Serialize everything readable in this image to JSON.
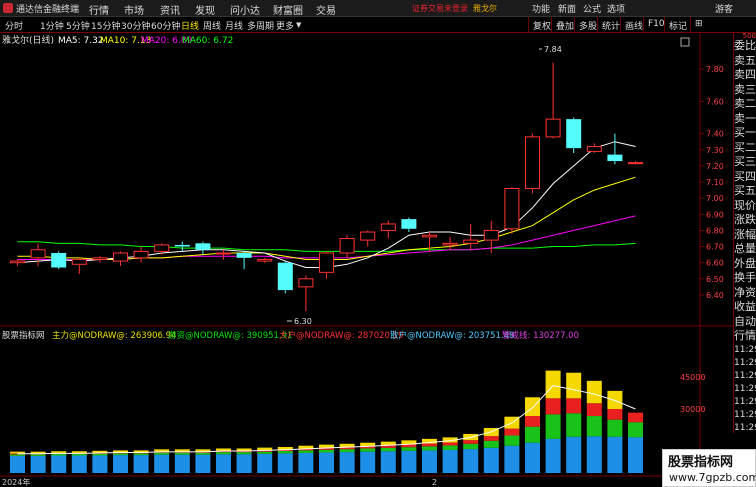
{
  "menubar": {
    "app_title": "通达信金融终端",
    "items": [
      "行情",
      "市场",
      "资讯",
      "发现",
      "问小达",
      "财富圈",
      "交易"
    ],
    "warning": "证券交易未登录",
    "username": "雅戈尔",
    "right_items": [
      "功能",
      "新面",
      "公式",
      "选项",
      "游客"
    ]
  },
  "period_bar": {
    "items": [
      "分时",
      "1分钟",
      "5分钟",
      "15分钟",
      "30分钟",
      "60分钟",
      "日线",
      "周线",
      "月线",
      "多周期",
      "更多"
    ],
    "active": "日线"
  },
  "toolbar_right": [
    "复权",
    "叠加",
    "多股",
    "统计",
    "画线",
    "F10",
    "标记",
    "⊞"
  ],
  "indicators": {
    "stock": "雅戈尔(日线)",
    "ma5": "MA5: 7.32",
    "ma10": "MA10: 7.13",
    "ma20": "MA20: 6.89",
    "ma60": "MA60: 6.72",
    "high_label": "7.84",
    "low_label": "6.30"
  },
  "sub_indicators": {
    "name": "股票指标网",
    "main": "主力@NODRAW@: 263906.94",
    "speculative": "游资@NODRAW@: 390951.91",
    "large": "大户@NODRAW@: 287020.19",
    "retail": "散户@NODRAW@: 203751.48",
    "warning": "警戒线: 130277.00"
  },
  "price_axis": [
    "7.80",
    "7.60",
    "7.40",
    "7.30",
    "7.20",
    "7.10",
    "7.00",
    "6.90",
    "6.80",
    "6.70",
    "6.60",
    "6.50",
    "6.40"
  ],
  "volume_axis": [
    "45000",
    "30000"
  ],
  "date_labels": {
    "year": "2024年",
    "month": "2"
  },
  "right_panel": {
    "rows": [
      "委比",
      "卖五",
      "卖四",
      "卖三",
      "卖二",
      "卖一",
      "买一",
      "买二",
      "买三",
      "买四",
      "买五",
      "现价",
      "涨跌",
      "涨幅",
      "总量",
      "外盘",
      "换手",
      "净资",
      "收益",
      "自动",
      "行情",
      "11:29",
      "11:29",
      "11:29",
      "11:29",
      "11:29",
      "11:29",
      "11:29"
    ],
    "top_number": "500"
  },
  "watermark": {
    "title": "股票指标网",
    "url": "www.7gpzb.com"
  },
  "colors": {
    "up": "#ff3232",
    "down": "#54fcfc",
    "ma5": "#ffffff",
    "ma10": "#ffff00",
    "ma20": "#ff00ff",
    "ma60": "#00ff00"
  },
  "chart_data": {
    "type": "candlestick",
    "ylim": [
      6.35,
      7.9
    ],
    "candles": [
      {
        "o": 6.6,
        "h": 6.62,
        "l": 6.58,
        "c": 6.61
      },
      {
        "o": 6.63,
        "h": 6.72,
        "l": 6.58,
        "c": 6.68
      },
      {
        "o": 6.66,
        "h": 6.67,
        "l": 6.56,
        "c": 6.57
      },
      {
        "o": 6.59,
        "h": 6.63,
        "l": 6.53,
        "c": 6.62
      },
      {
        "o": 6.62,
        "h": 6.64,
        "l": 6.6,
        "c": 6.63
      },
      {
        "o": 6.61,
        "h": 6.67,
        "l": 6.58,
        "c": 6.66
      },
      {
        "o": 6.63,
        "h": 6.7,
        "l": 6.6,
        "c": 6.67
      },
      {
        "o": 6.67,
        "h": 6.72,
        "l": 6.65,
        "c": 6.71
      },
      {
        "o": 6.71,
        "h": 6.73,
        "l": 6.67,
        "c": 6.7
      },
      {
        "o": 6.72,
        "h": 6.73,
        "l": 6.65,
        "c": 6.68
      },
      {
        "o": 6.66,
        "h": 6.68,
        "l": 6.62,
        "c": 6.66
      },
      {
        "o": 6.66,
        "h": 6.67,
        "l": 6.56,
        "c": 6.63
      },
      {
        "o": 6.61,
        "h": 6.63,
        "l": 6.6,
        "c": 6.62
      },
      {
        "o": 6.6,
        "h": 6.61,
        "l": 6.41,
        "c": 6.43
      },
      {
        "o": 6.45,
        "h": 6.52,
        "l": 6.3,
        "c": 6.5
      },
      {
        "o": 6.54,
        "h": 6.67,
        "l": 6.5,
        "c": 6.66
      },
      {
        "o": 6.66,
        "h": 6.77,
        "l": 6.63,
        "c": 6.75
      },
      {
        "o": 6.74,
        "h": 6.8,
        "l": 6.7,
        "c": 6.79
      },
      {
        "o": 6.8,
        "h": 6.86,
        "l": 6.75,
        "c": 6.84
      },
      {
        "o": 6.87,
        "h": 6.88,
        "l": 6.79,
        "c": 6.81
      },
      {
        "o": 6.76,
        "h": 6.79,
        "l": 6.67,
        "c": 6.77
      },
      {
        "o": 6.71,
        "h": 6.76,
        "l": 6.68,
        "c": 6.72
      },
      {
        "o": 6.72,
        "h": 6.84,
        "l": 6.68,
        "c": 6.74
      },
      {
        "o": 6.74,
        "h": 6.86,
        "l": 6.66,
        "c": 6.8
      },
      {
        "o": 6.81,
        "h": 7.07,
        "l": 6.78,
        "c": 7.06
      },
      {
        "o": 7.06,
        "h": 7.4,
        "l": 7.03,
        "c": 7.38
      },
      {
        "o": 7.38,
        "h": 7.84,
        "l": 7.37,
        "c": 7.49
      },
      {
        "o": 7.49,
        "h": 7.5,
        "l": 7.28,
        "c": 7.31
      },
      {
        "o": 7.29,
        "h": 7.34,
        "l": 7.28,
        "c": 7.32
      },
      {
        "o": 7.27,
        "h": 7.4,
        "l": 7.21,
        "c": 7.23
      },
      {
        "o": 7.22,
        "h": 7.23,
        "l": 7.21,
        "c": 7.22
      }
    ],
    "ma5": [
      6.6,
      6.61,
      6.62,
      6.61,
      6.62,
      6.63,
      6.64,
      6.66,
      6.67,
      6.68,
      6.68,
      6.67,
      6.66,
      6.61,
      6.57,
      6.57,
      6.59,
      6.63,
      6.69,
      6.77,
      6.79,
      6.79,
      6.77,
      6.77,
      6.82,
      6.94,
      7.09,
      7.2,
      7.31,
      7.35,
      7.32
    ],
    "ma10": [
      6.64,
      6.64,
      6.63,
      6.63,
      6.62,
      6.62,
      6.63,
      6.63,
      6.64,
      6.65,
      6.66,
      6.66,
      6.66,
      6.64,
      6.62,
      6.62,
      6.62,
      6.64,
      6.66,
      6.68,
      6.69,
      6.7,
      6.72,
      6.75,
      6.79,
      6.83,
      6.91,
      6.99,
      7.05,
      7.09,
      7.13
    ],
    "ma20": [
      6.62,
      6.62,
      6.62,
      6.62,
      6.62,
      6.62,
      6.63,
      6.63,
      6.64,
      6.64,
      6.64,
      6.64,
      6.64,
      6.63,
      6.63,
      6.63,
      6.63,
      6.64,
      6.65,
      6.66,
      6.67,
      6.68,
      6.68,
      6.69,
      6.71,
      6.74,
      6.77,
      6.8,
      6.83,
      6.86,
      6.89
    ],
    "ma60": [
      6.73,
      6.73,
      6.72,
      6.72,
      6.71,
      6.71,
      6.7,
      6.7,
      6.69,
      6.69,
      6.69,
      6.68,
      6.68,
      6.68,
      6.67,
      6.67,
      6.67,
      6.67,
      6.67,
      6.68,
      6.68,
      6.68,
      6.68,
      6.69,
      6.69,
      6.69,
      6.7,
      6.7,
      6.71,
      6.71,
      6.72
    ],
    "volume_ylim": [
      0,
      60000
    ],
    "volumes": [
      {
        "blue": 8000,
        "green": 700,
        "red": 500,
        "yellow": 800
      },
      {
        "blue": 8000,
        "green": 700,
        "red": 500,
        "yellow": 800
      },
      {
        "blue": 8200,
        "green": 700,
        "red": 500,
        "yellow": 800
      },
      {
        "blue": 8200,
        "green": 700,
        "red": 500,
        "yellow": 800
      },
      {
        "blue": 8200,
        "green": 800,
        "red": 500,
        "yellow": 900
      },
      {
        "blue": 8400,
        "green": 800,
        "red": 500,
        "yellow": 900
      },
      {
        "blue": 8400,
        "green": 800,
        "red": 500,
        "yellow": 900
      },
      {
        "blue": 8600,
        "green": 900,
        "red": 600,
        "yellow": 1000
      },
      {
        "blue": 8600,
        "green": 900,
        "red": 600,
        "yellow": 1000
      },
      {
        "blue": 8600,
        "green": 900,
        "red": 600,
        "yellow": 1000
      },
      {
        "blue": 8800,
        "green": 1000,
        "red": 600,
        "yellow": 1100
      },
      {
        "blue": 8800,
        "green": 1000,
        "red": 600,
        "yellow": 1100
      },
      {
        "blue": 9000,
        "green": 1000,
        "red": 700,
        "yellow": 1200
      },
      {
        "blue": 9200,
        "green": 1100,
        "red": 700,
        "yellow": 1200
      },
      {
        "blue": 9400,
        "green": 1200,
        "red": 800,
        "yellow": 1400
      },
      {
        "blue": 9600,
        "green": 1300,
        "red": 900,
        "yellow": 1500
      },
      {
        "blue": 9800,
        "green": 1400,
        "red": 900,
        "yellow": 1600
      },
      {
        "blue": 10000,
        "green": 1500,
        "red": 1000,
        "yellow": 1700
      },
      {
        "blue": 10200,
        "green": 1600,
        "red": 1100,
        "yellow": 1800
      },
      {
        "blue": 10400,
        "green": 1700,
        "red": 1200,
        "yellow": 2000
      },
      {
        "blue": 10600,
        "green": 1900,
        "red": 1300,
        "yellow": 2200
      },
      {
        "blue": 10800,
        "green": 2100,
        "red": 1400,
        "yellow": 2400
      },
      {
        "blue": 11200,
        "green": 2500,
        "red": 1700,
        "yellow": 2900
      },
      {
        "blue": 11800,
        "green": 3300,
        "red": 2200,
        "yellow": 3800
      },
      {
        "blue": 12800,
        "green": 4800,
        "red": 3200,
        "yellow": 5600
      },
      {
        "blue": 14200,
        "green": 7500,
        "red": 5000,
        "yellow": 8800
      },
      {
        "blue": 16000,
        "green": 11500,
        "red": 7500,
        "yellow": 13000
      },
      {
        "blue": 17000,
        "green": 11000,
        "red": 7000,
        "yellow": 12000
      },
      {
        "blue": 17200,
        "green": 9500,
        "red": 6000,
        "yellow": 10500
      },
      {
        "blue": 17000,
        "green": 8000,
        "red": 5000,
        "yellow": 8500
      },
      {
        "blue": 16800,
        "green": 7000,
        "red": 4500,
        "yellow": 0
      }
    ],
    "volume_line": [
      9000,
      9000,
      9200,
      9200,
      9400,
      9600,
      9600,
      9900,
      9900,
      9900,
      10300,
      10300,
      10600,
      10900,
      11300,
      11700,
      12100,
      12500,
      13000,
      13500,
      14300,
      15100,
      16700,
      19300,
      23500,
      30500,
      41000,
      39000,
      37000,
      34000,
      30000
    ]
  }
}
